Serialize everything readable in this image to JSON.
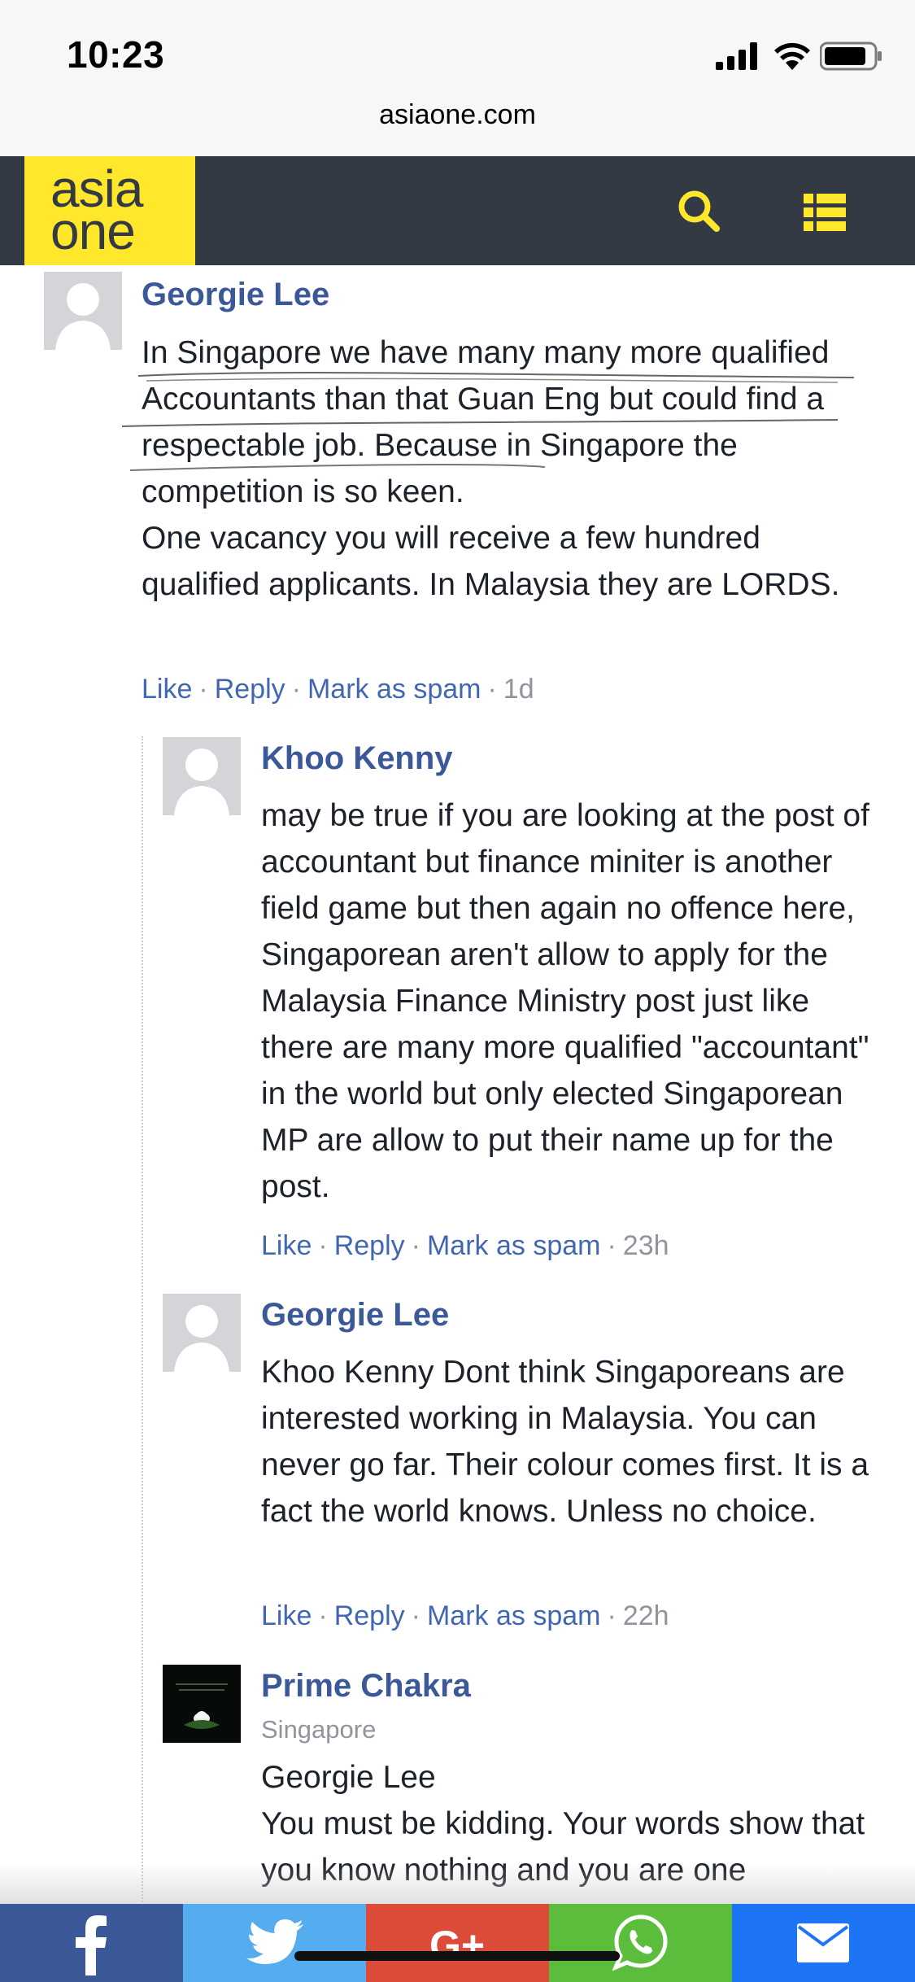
{
  "status_bar": {
    "time": "10:23"
  },
  "browser": {
    "url": "asiaone.com"
  },
  "site": {
    "logo_line1": "asia",
    "logo_line2": "one"
  },
  "comments": [
    {
      "name": "Georgie Lee",
      "location": "",
      "text": "In Singapore we have many many more qualified Accountants than that Guan Eng but could find a respectable job. Because in Singapore the competition is so keen.\nOne vacancy you will receive a few hundred qualified applicants. In Malaysia they are LORDS.",
      "like": "Like",
      "reply": "Reply",
      "spam": "Mark as spam",
      "age": "1d"
    },
    {
      "name": "Khoo Kenny",
      "location": "",
      "text": "may be true if you are looking at the post of accountant but finance miniter is another field game but then again no offence here, Singaporean aren't allow to apply for the Malaysia Finance Ministry post just like there are many more qualified \"accountant\" in the world but only elected Singaporean MP are allow to put their name up for the post.",
      "like": "Like",
      "reply": "Reply",
      "spam": "Mark as spam",
      "age": "23h"
    },
    {
      "name": "Georgie Lee",
      "location": "",
      "text": "Khoo Kenny Dont think Singaporeans are interested working in Malaysia. You can never go far. Their colour comes first. It is a fact the world knows. Unless no choice.",
      "like": "Like",
      "reply": "Reply",
      "spam": "Mark as spam",
      "age": "22h"
    },
    {
      "name": "Prime Chakra",
      "location": "Singapore",
      "text": "Georgie Lee\nYou must be kidding. Your words show that you know nothing and you are one"
    }
  ],
  "share_bar": {
    "items": [
      "facebook-icon",
      "twitter-icon",
      "google-plus-icon",
      "whatsapp-icon",
      "email-icon"
    ],
    "gplus_label": "G+"
  },
  "colors": {
    "header": "#343a44",
    "logo_bg": "#ffe82b",
    "name": "#3b5998",
    "link": "#4267b2",
    "facebook": "#3b5998",
    "twitter": "#55acee",
    "google": "#dd4b39",
    "whatsapp": "#5cbd3c",
    "email": "#1d74f5"
  }
}
